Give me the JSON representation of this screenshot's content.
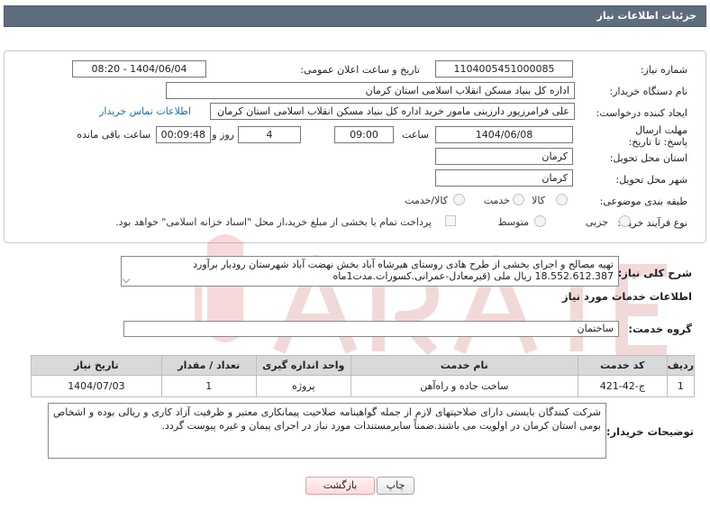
{
  "header": {
    "title": "جزئیات اطلاعات نیاز"
  },
  "form": {
    "need_number_label": "شماره نیاز:",
    "need_number": "1104005451000085",
    "announce_label": "تاریخ و ساعت اعلان عمومی:",
    "announce_value": "1404/06/04 - 08:20",
    "buyer_org_label": "نام دستگاه خریدار:",
    "buyer_org": "اداره کل بنیاد مسکن انقلاب اسلامی استان کرمان",
    "creator_label": "ایجاد کننده درخواست:",
    "creator": "علی فرامرزپور دارزینی مامور خرید اداره کل بنیاد مسکن انقلاب اسلامی استان کرمان",
    "contact_link": "اطلاعات تماس خریدار",
    "deadline_label": "مهلت ارسال پاسخ: تا تاریخ:",
    "deadline_date": "1404/06/08",
    "time_label": "ساعت",
    "deadline_time": "09:00",
    "days_value": "4",
    "days_label": "روز و",
    "remaining_time": "00:09:48",
    "remaining_label": "ساعت باقی مانده",
    "province_label": "استان محل تحویل:",
    "province": "کرمان",
    "city_label": "شهر محل تحویل:",
    "city": "کرمان",
    "category_label": "طبقه بندی موضوعی:",
    "category_options": [
      "کالا",
      "خدمت",
      "کالا/خدمت"
    ],
    "process_label": "نوع فرآیند خرید :",
    "process_options": [
      "جزیی",
      "متوسط"
    ],
    "payment_note": "پرداخت تمام یا بخشی از مبلغ خرید،از محل \"اسناد خزانه اسلامی\" خواهد بود."
  },
  "summary": {
    "label": "شرح کلی نیاز:",
    "text": "تهیه مصالح و اجرای بخشی از طرح هادی روستای هیرشاه آباد بخش نهضت آباد شهرستان رودبار برآورد 18.552.612.387 ریال ملی (قیرمعادل-عمرانی.کسورات.مدت1ماه"
  },
  "services": {
    "title": "اطلاعات خدمات مورد نیاز",
    "group_label": "گروه خدمت:",
    "group_value": "ساختمان",
    "columns": [
      "ردیف",
      "کد خدمت",
      "نام خدمت",
      "واحد اندازه گیری",
      "تعداد / مقدار",
      "تاریخ نیاز"
    ],
    "rows": [
      [
        "1",
        "ج-42-421",
        "ساخت جاده و راه‌آهن",
        "پروژه",
        "1",
        "1404/07/03"
      ]
    ]
  },
  "buyer_notes": {
    "label": "توضیحات خریدار:",
    "text": "شرکت کنندگان بایستی دارای صلاحیتهای لازم از جمله گواهینامه صلاحیت پیمانکاری معتبر و ظرفیت آزاد کاری و ریالی بوده و اشخاص بومی استان کرمان در اولویت می باشند.ضمناً سایرمستندات مورد نیاز در اجرای پیمان و غیره پیوست گردد."
  },
  "buttons": {
    "print": "چاپ",
    "back": "بازگشت"
  },
  "colors": {
    "titlebar": "#5e6d7e",
    "link": "#1a6fb5",
    "table_header": "#d9d9d9"
  }
}
